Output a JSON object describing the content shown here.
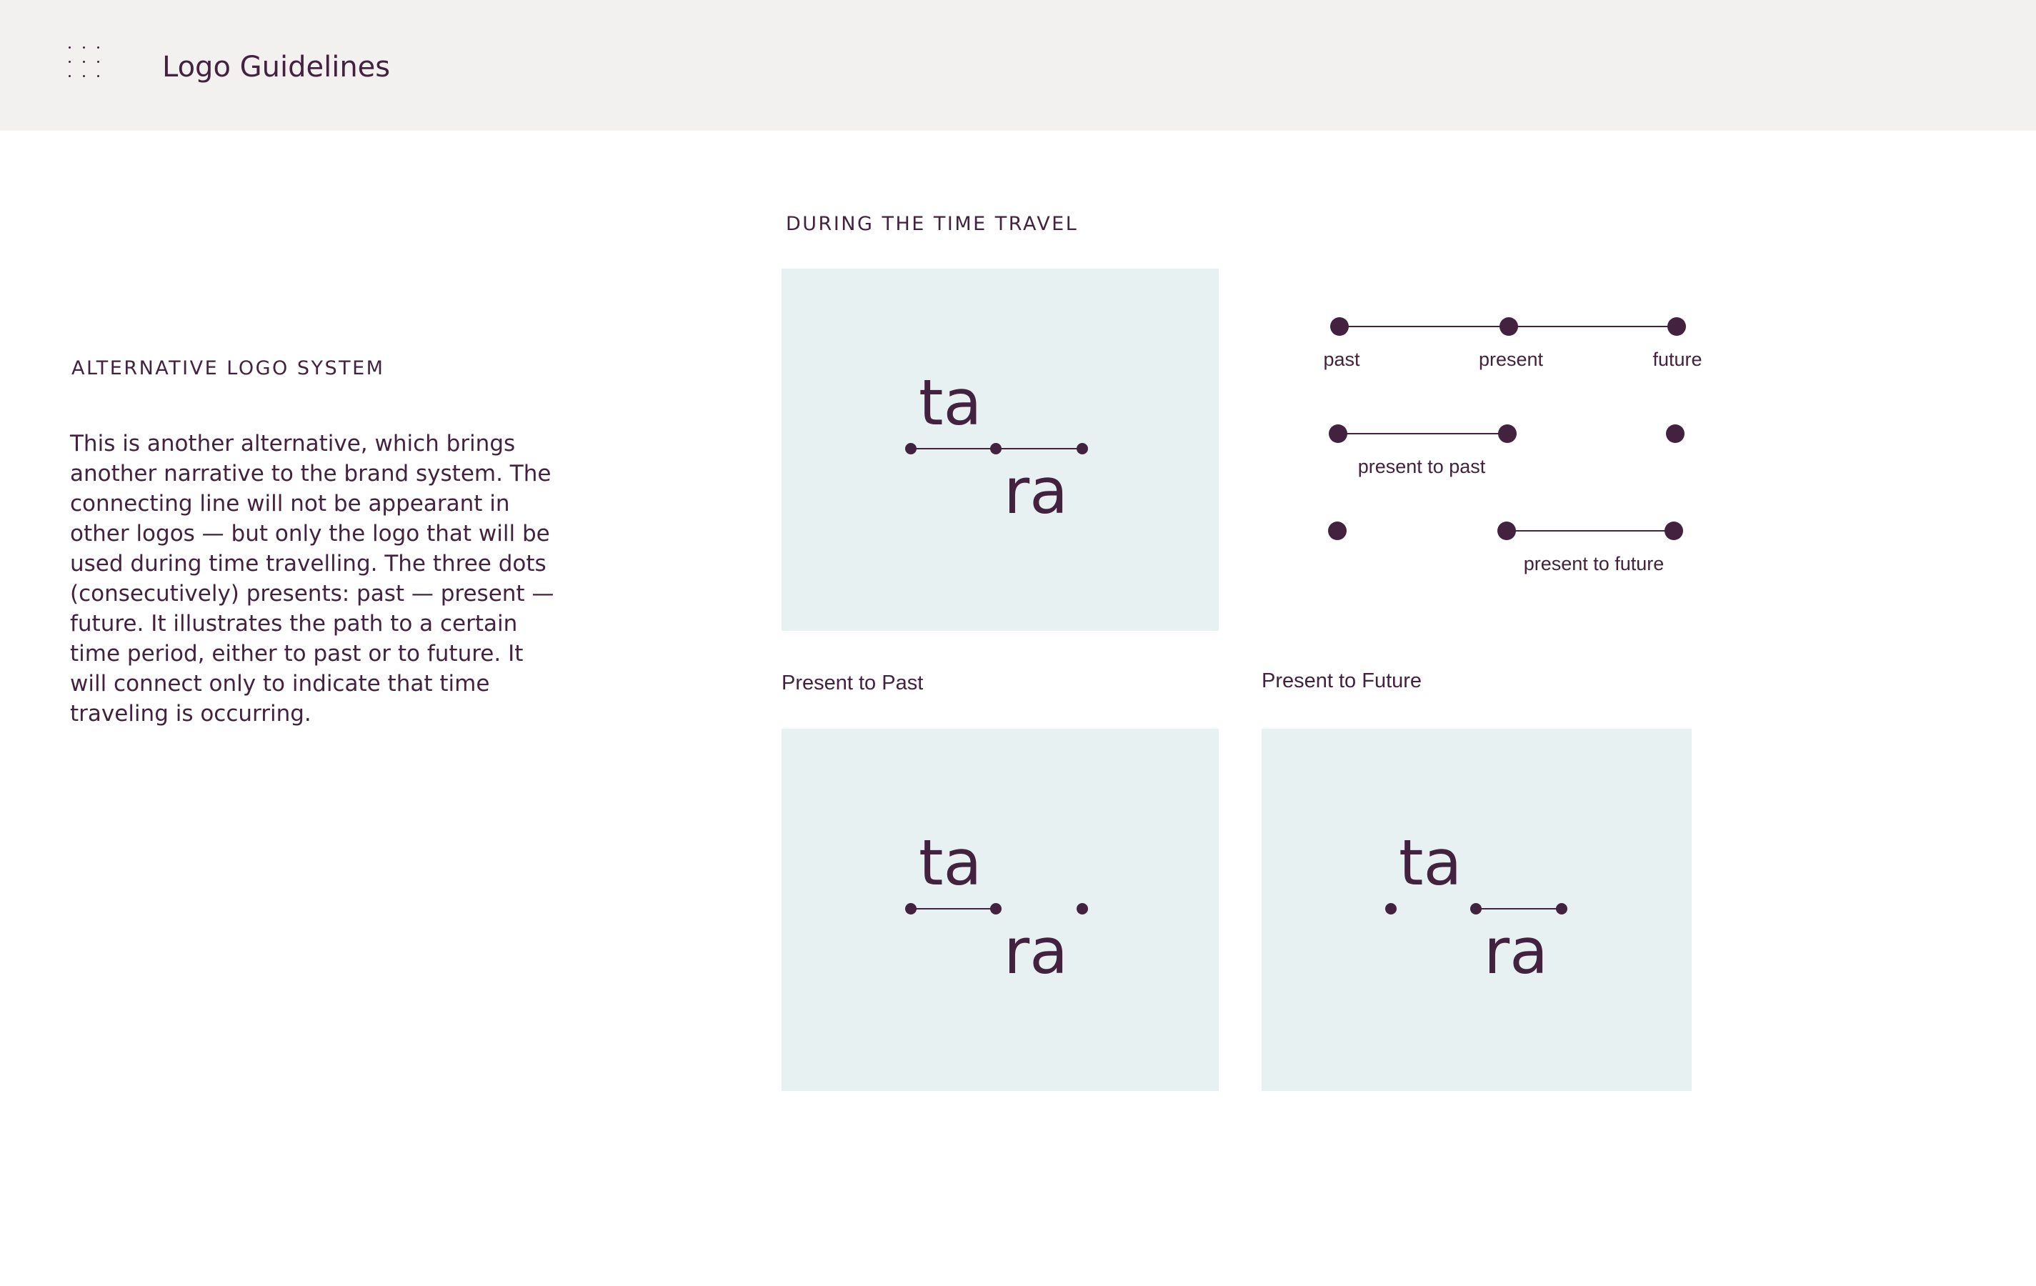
{
  "header": {
    "menu_icon": "grid-dots-icon",
    "title": "Logo Guidelines"
  },
  "sidebar": {
    "section_label": "ALTERNATIVE LOGO SYSTEM",
    "body": "This is another alternative, which brings another narrative to the brand system. The connecting line will not be appearant in other logos — but only the logo that will be used during time travelling. The three dots (consecutively) presents: past — present — future. It illustrates the path to a certain time period, either to past or to future. It will connect only to indicate that time traveling is occurring."
  },
  "main": {
    "section_label": "DURING THE TIME TRAVEL",
    "logo": {
      "top": "ta",
      "bottom": "ra"
    },
    "diagram": {
      "row1": {
        "past": "past",
        "present": "present",
        "future": "future"
      },
      "row2": {
        "label": "present to past"
      },
      "row3": {
        "label": "present to future"
      }
    },
    "panels": [
      {
        "caption": "Present to Past"
      },
      {
        "caption": "Present to Future"
      }
    ]
  },
  "colors": {
    "brand": "#43223f",
    "header_bg": "#f2f1f0",
    "panel_bg": "#e8f1f2"
  }
}
